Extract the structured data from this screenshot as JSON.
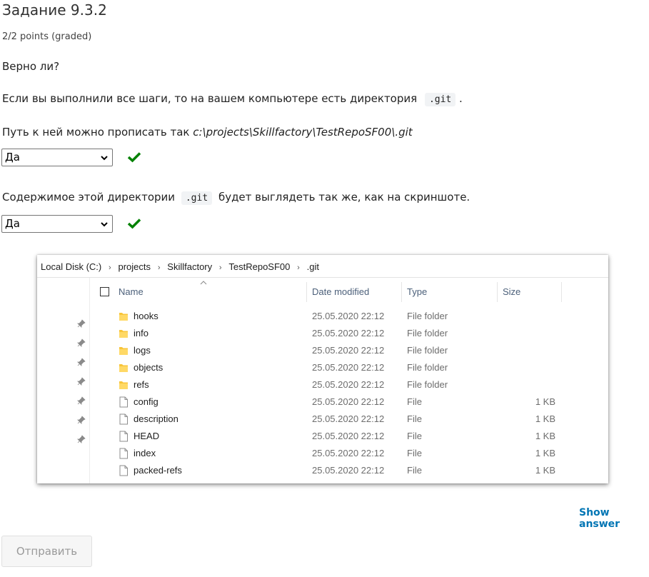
{
  "problem": {
    "title": "Задание 9.3.2",
    "points": "2/2 points (graded)",
    "question": "Верно ли?",
    "intro_text": "Если вы выполнили все шаги, то на вашем компьютере есть директория",
    "intro_code": ".git",
    "intro_end": ".",
    "q1_text": "Путь к ней можно прописать так ",
    "q1_path": "c:\\projects\\Skillfactory\\TestRepoSF00\\.git",
    "q1_answer": "Да",
    "q2_text_before": "Содержимое этой директории",
    "q2_code": ".git",
    "q2_text_after": "будет выглядеть так же, как на скриншоте.",
    "q2_answer": "Да"
  },
  "explorer": {
    "breadcrumb": [
      "Local Disk (C:)",
      "projects",
      "Skillfactory",
      "TestRepoSF00",
      ".git"
    ],
    "columns": {
      "name": "Name",
      "date": "Date modified",
      "type": "Type",
      "size": "Size"
    },
    "files": [
      {
        "name": "hooks",
        "date": "25.05.2020 22:12",
        "type": "File folder",
        "size": "",
        "icon": "folder-icon"
      },
      {
        "name": "info",
        "date": "25.05.2020 22:12",
        "type": "File folder",
        "size": "",
        "icon": "folder-icon"
      },
      {
        "name": "logs",
        "date": "25.05.2020 22:12",
        "type": "File folder",
        "size": "",
        "icon": "folder-icon"
      },
      {
        "name": "objects",
        "date": "25.05.2020 22:12",
        "type": "File folder",
        "size": "",
        "icon": "folder-icon"
      },
      {
        "name": "refs",
        "date": "25.05.2020 22:12",
        "type": "File folder",
        "size": "",
        "icon": "folder-icon"
      },
      {
        "name": "config",
        "date": "25.05.2020 22:12",
        "type": "File",
        "size": "1 KB",
        "icon": "file-icon"
      },
      {
        "name": "description",
        "date": "25.05.2020 22:12",
        "type": "File",
        "size": "1 KB",
        "icon": "file-icon"
      },
      {
        "name": "HEAD",
        "date": "25.05.2020 22:12",
        "type": "File",
        "size": "1 KB",
        "icon": "file-icon"
      },
      {
        "name": "index",
        "date": "25.05.2020 22:12",
        "type": "File",
        "size": "1 KB",
        "icon": "file-icon"
      },
      {
        "name": "packed-refs",
        "date": "25.05.2020 22:12",
        "type": "File",
        "size": "1 KB",
        "icon": "file-icon"
      }
    ]
  },
  "actions": {
    "show_answer": "Show answer",
    "submit": "Отправить"
  },
  "colors": {
    "correct": "#008100",
    "link": "#0075b4",
    "folder": "#f8c53a"
  }
}
